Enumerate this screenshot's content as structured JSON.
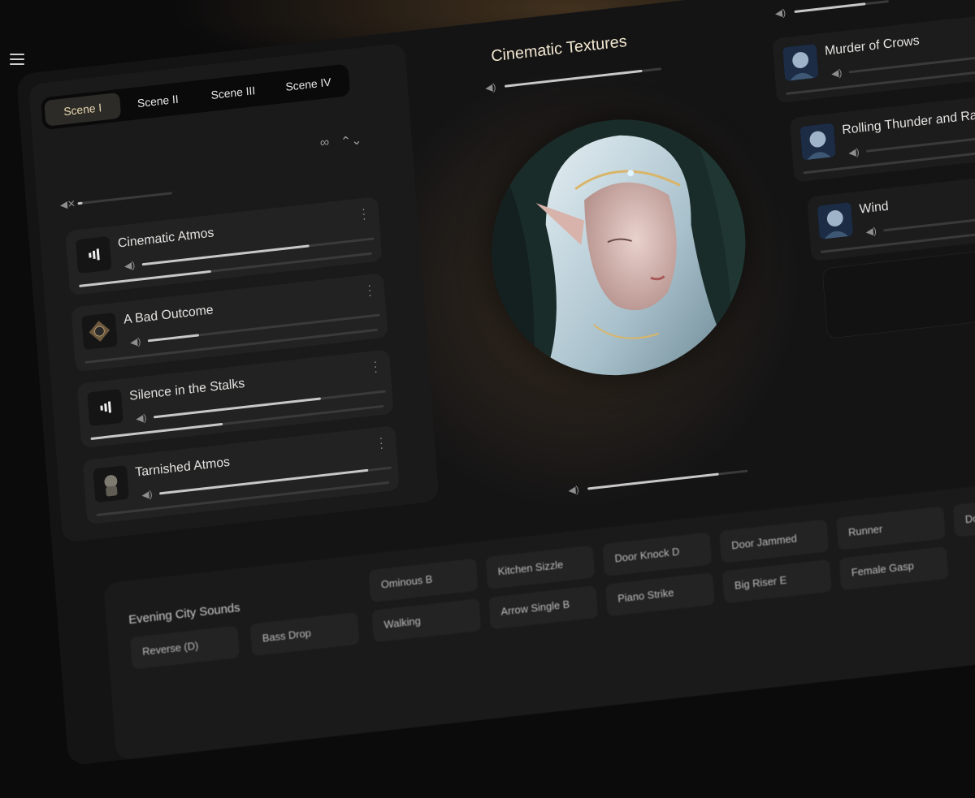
{
  "header": {
    "menu_icon": "hamburger-icon"
  },
  "tabs": [
    {
      "label": "Scene I",
      "active": true
    },
    {
      "label": "Scene II",
      "active": false
    },
    {
      "label": "Scene III",
      "active": false
    },
    {
      "label": "Scene IV",
      "active": false
    }
  ],
  "left_controls": {
    "loop_icon": "infinity-icon",
    "collapse_icon": "chevron-updown-icon",
    "master_volume": 0.05
  },
  "left_tracks": [
    {
      "title": "Cinematic Atmos",
      "volume": 0.72,
      "progress": 0.45,
      "thumb": "bars"
    },
    {
      "title": "A Bad Outcome",
      "volume": 0.22,
      "progress": 0.0,
      "thumb": "ornament"
    },
    {
      "title": "Silence in the Stalks",
      "volume": 0.72,
      "progress": 0.45,
      "thumb": "bars"
    },
    {
      "title": "Tarnished Atmos",
      "volume": 0.9,
      "progress": 0.0,
      "thumb": "statue"
    }
  ],
  "center": {
    "title": "Cinematic Textures",
    "volume": 0.88,
    "image": "elf-portrait"
  },
  "right_master_volume": 0.75,
  "right_tracks": [
    {
      "title": "Murder of Crows",
      "volume": 0.0,
      "progress": 0.0
    },
    {
      "title": "Rolling Thunder and Rain",
      "volume": 0.0,
      "progress": 0.0
    },
    {
      "title": "Wind",
      "volume": 0.0,
      "progress": 0.0
    }
  ],
  "bottom_volume": 0.82,
  "soundboard": {
    "title": "Evening City Sounds",
    "pads": [
      "Reverse (D)",
      "Bass Drop",
      "Ominous B",
      "Kitchen Sizzle",
      "Door Knock D",
      "Door Jammed",
      "Runner",
      "Door L",
      "Walking",
      "Arrow Single B",
      "Piano Strike",
      "Big Riser E",
      "Female Gasp"
    ]
  },
  "colors": {
    "accent": "#ead8b0",
    "panel": "#1a1a1b",
    "card": "#222223",
    "background": "#0b0b0c"
  }
}
